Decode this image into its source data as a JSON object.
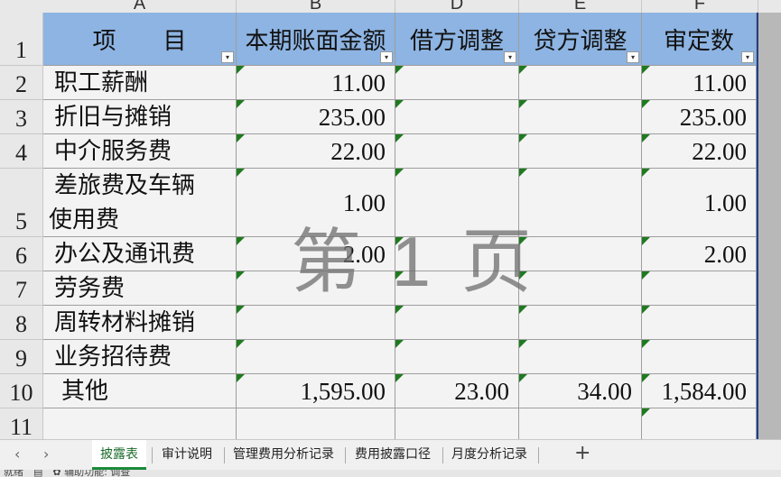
{
  "columns": [
    "A",
    "B",
    "D",
    "E",
    "F"
  ],
  "header": {
    "item_label": "项　　目",
    "book_amount": "本期账面金额",
    "debit_adj": "借方调整",
    "credit_adj": "贷方调整",
    "audited": "审定数",
    "filter_glyph": "▾"
  },
  "rows": [
    {
      "num": "1"
    },
    {
      "num": "2",
      "item": "职工薪酬",
      "book": "11.00",
      "debit": "",
      "credit": "",
      "audited": "11.00"
    },
    {
      "num": "3",
      "item": "折旧与摊销",
      "book": "235.00",
      "debit": "",
      "credit": "",
      "audited": "235.00"
    },
    {
      "num": "4",
      "item": "中介服务费",
      "book": "22.00",
      "debit": "",
      "credit": "",
      "audited": "22.00"
    },
    {
      "num": "5",
      "item_line1": "差旅费及车辆",
      "item_line2": "使用费",
      "book": "1.00",
      "debit": "",
      "credit": "",
      "audited": "1.00"
    },
    {
      "num": "6",
      "item": "办公及通讯费",
      "book": "2.00",
      "debit": "",
      "credit": "",
      "audited": "2.00"
    },
    {
      "num": "7",
      "item": "劳务费",
      "book": "",
      "debit": "",
      "credit": "",
      "audited": ""
    },
    {
      "num": "8",
      "item": "周转材料摊销",
      "book": "",
      "debit": "",
      "credit": "",
      "audited": ""
    },
    {
      "num": "9",
      "item": "业务招待费",
      "book": "",
      "debit": "",
      "credit": "",
      "audited": ""
    },
    {
      "num": "10",
      "item": "其他",
      "book": "1,595.00",
      "debit": "23.00",
      "credit": "34.00",
      "audited": "1,584.00"
    },
    {
      "num": "11"
    }
  ],
  "watermark": "第 1 页",
  "tabs": {
    "prev": "‹",
    "next": "›",
    "items": [
      "披露表",
      "审计说明",
      "管理费用分析记录",
      "费用披露口径",
      "月度分析记录"
    ],
    "active": "披露表",
    "add": "+"
  },
  "status": {
    "text": "就绪　▤　✿ 辅助功能: 调查"
  }
}
